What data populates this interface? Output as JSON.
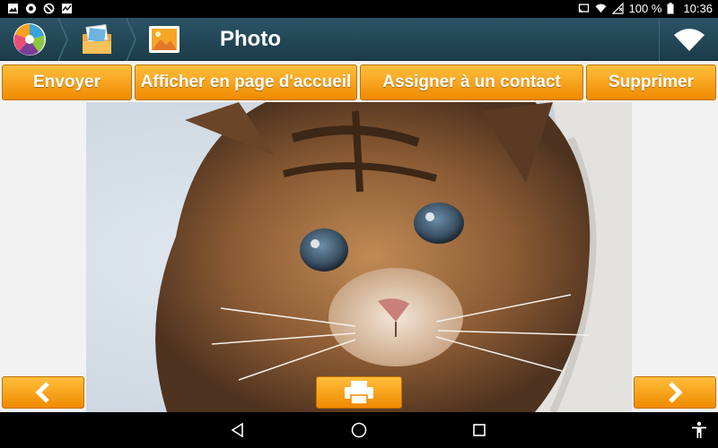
{
  "status_bar": {
    "battery": "100 %",
    "time": "10:36"
  },
  "header": {
    "title": "Photo",
    "breadcrumbs": [
      "app-logo-icon",
      "photos-folder-icon",
      "image-icon"
    ],
    "right_icon": "wifi-icon"
  },
  "actions": {
    "send": "Envoyer",
    "show_home": "Afficher en page d'accueil",
    "assign_contact": "Assigner à un contact",
    "delete": "Supprimer"
  },
  "photo": {
    "subject": "kitten-photo"
  },
  "photo_nav": {
    "prev_icon": "chevron-left-icon",
    "print_icon": "printer-icon",
    "next_icon": "chevron-right-icon"
  },
  "system_nav": {
    "back_icon": "back-triangle-icon",
    "home_icon": "home-circle-icon",
    "recents_icon": "recents-square-icon",
    "accessibility_icon": "accessibility-icon"
  },
  "colors": {
    "header": "#1f4453",
    "button": "#f7a21b",
    "button_border": "#c56f00"
  }
}
